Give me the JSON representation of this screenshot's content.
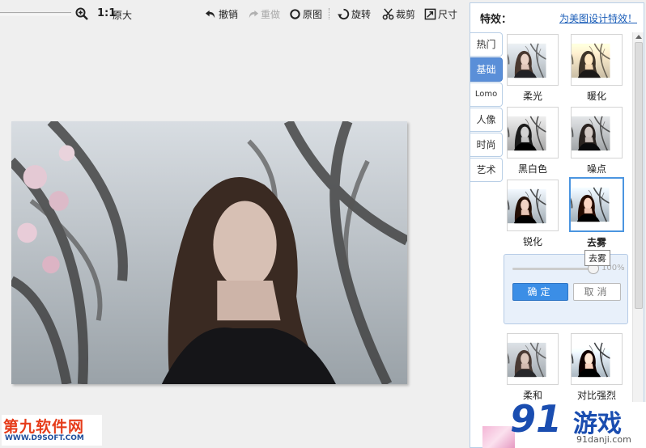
{
  "toolbar": {
    "zoom_ratio": "1:1",
    "original_size": "原大",
    "undo": "撤销",
    "redo": "重做",
    "original": "原图",
    "rotate": "旋转",
    "crop": "裁剪",
    "size": "尺寸"
  },
  "panel": {
    "title": "特效：",
    "link": "为美图设计特效！",
    "tabs": [
      {
        "label": "热门"
      },
      {
        "label": "基础"
      },
      {
        "label": "Lomo"
      },
      {
        "label": "人像"
      },
      {
        "label": "时尚"
      },
      {
        "label": "艺术"
      }
    ],
    "effects": {
      "soft_light": "柔光",
      "warm": "暖化",
      "black_white": "黑白色",
      "noise": "噪点",
      "sharpen": "锐化",
      "dehaze": "去雾",
      "gentle": "柔和",
      "strong_contrast": "对比强烈"
    },
    "adjust": {
      "tooltip": "去雾",
      "value": "100%",
      "level": 1.0,
      "ok": "确定",
      "cancel": "取消"
    }
  },
  "watermarks": {
    "left_title": "第九软件网",
    "left_url": "WWW.D9SOFT.COM",
    "right_logo": "91",
    "right_name": "游戏",
    "right_url": "91danji.com"
  },
  "colors": {
    "accent": "#5a8fd8",
    "ok_button": "#3b8ee6",
    "link": "#1a5db8"
  }
}
